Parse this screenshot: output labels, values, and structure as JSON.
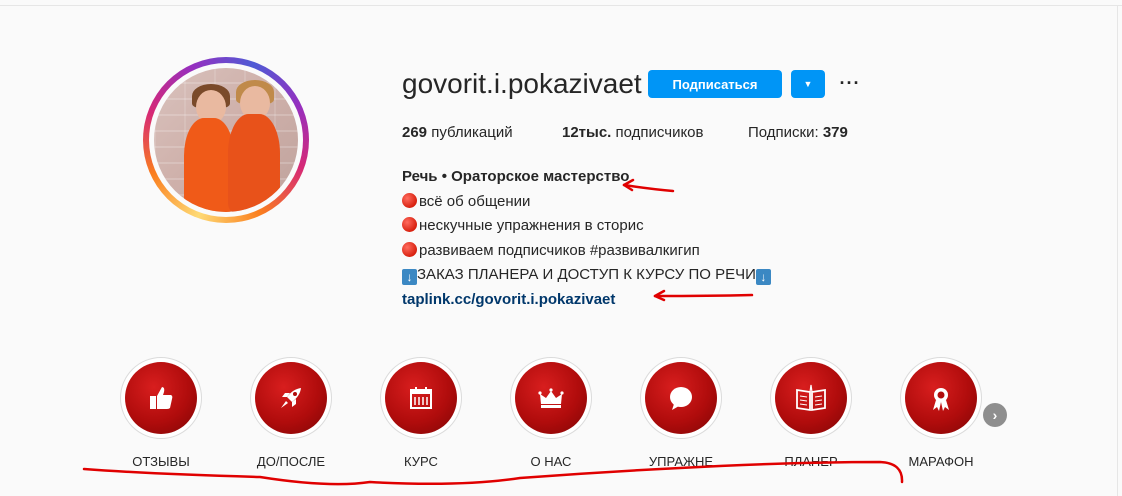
{
  "profile": {
    "username": "govorit.i.pokazivaet",
    "follow_label": "Подписаться",
    "more_label": "···",
    "stats": {
      "posts_count": "269",
      "posts_label": "публикаций",
      "followers_count": "12тыс.",
      "followers_label": "подписчиков",
      "following_label": "Подписки:",
      "following_count": "379"
    },
    "bio": {
      "name": "Речь • Ораторское мастерство",
      "lines": [
        "всё об общении",
        "нескучные упражнения в сторис",
        "развиваем подписчиков #развивалкигип",
        "ЗАКАЗ ПЛАНЕРА И ДОСТУП К КУРСУ ПО РЕЧИ"
      ],
      "link": "taplink.cc/govorit.i.pokazivaet"
    }
  },
  "highlights": [
    {
      "label": "ОТЗЫВЫ",
      "icon": "thumbs-up-icon"
    },
    {
      "label": "ДО/ПОСЛЕ",
      "icon": "rocket-icon"
    },
    {
      "label": "КУРС",
      "icon": "calendar-icon"
    },
    {
      "label": "О НАС",
      "icon": "crown-icon"
    },
    {
      "label": "УПРАЖНЕ",
      "icon": "speech-bubble-icon"
    },
    {
      "label": "ПЛАНЕР",
      "icon": "open-book-icon"
    },
    {
      "label": "МАРАФОН",
      "icon": "award-ribbon-icon"
    }
  ],
  "colors": {
    "accent": "#0095f6",
    "link": "#00376b",
    "highlight_red": "#b00c0c",
    "annotation_red": "#e00000"
  }
}
